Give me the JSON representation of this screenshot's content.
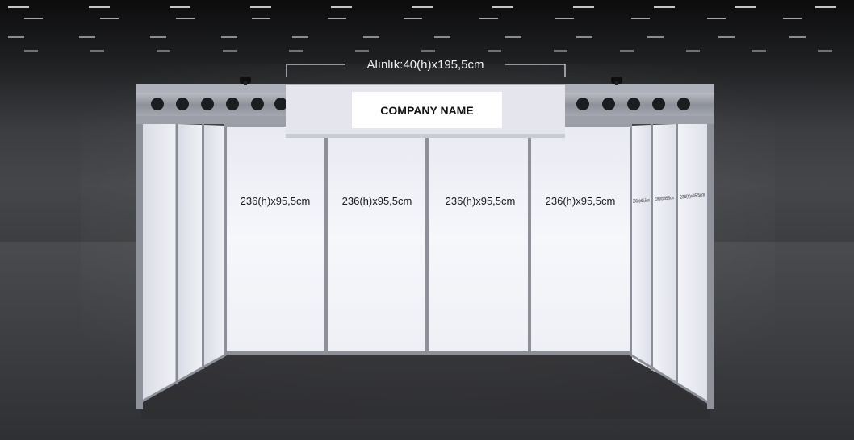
{
  "fascia": {
    "dimension_label": "Alınlık:40(h)x195,5cm",
    "company_name": "COMPANY NAME"
  },
  "back_panels": [
    {
      "label": "236(h)x95,5cm"
    },
    {
      "label": "236(h)x95,5cm"
    },
    {
      "label": "236(h)x95,5cm"
    },
    {
      "label": "236(h)x95,5cm"
    }
  ],
  "right_side_panels": [
    {
      "label": "236(h)x95,5cm"
    },
    {
      "label": "236(h)x95,5cm"
    },
    {
      "label": "236(h)x95,5cm"
    }
  ],
  "colors": {
    "panel_white": "#f4f5f9",
    "fascia_board": "#e3e4ec",
    "frame_aluminium": "#9a9da5",
    "background": "#3a3b3d"
  }
}
